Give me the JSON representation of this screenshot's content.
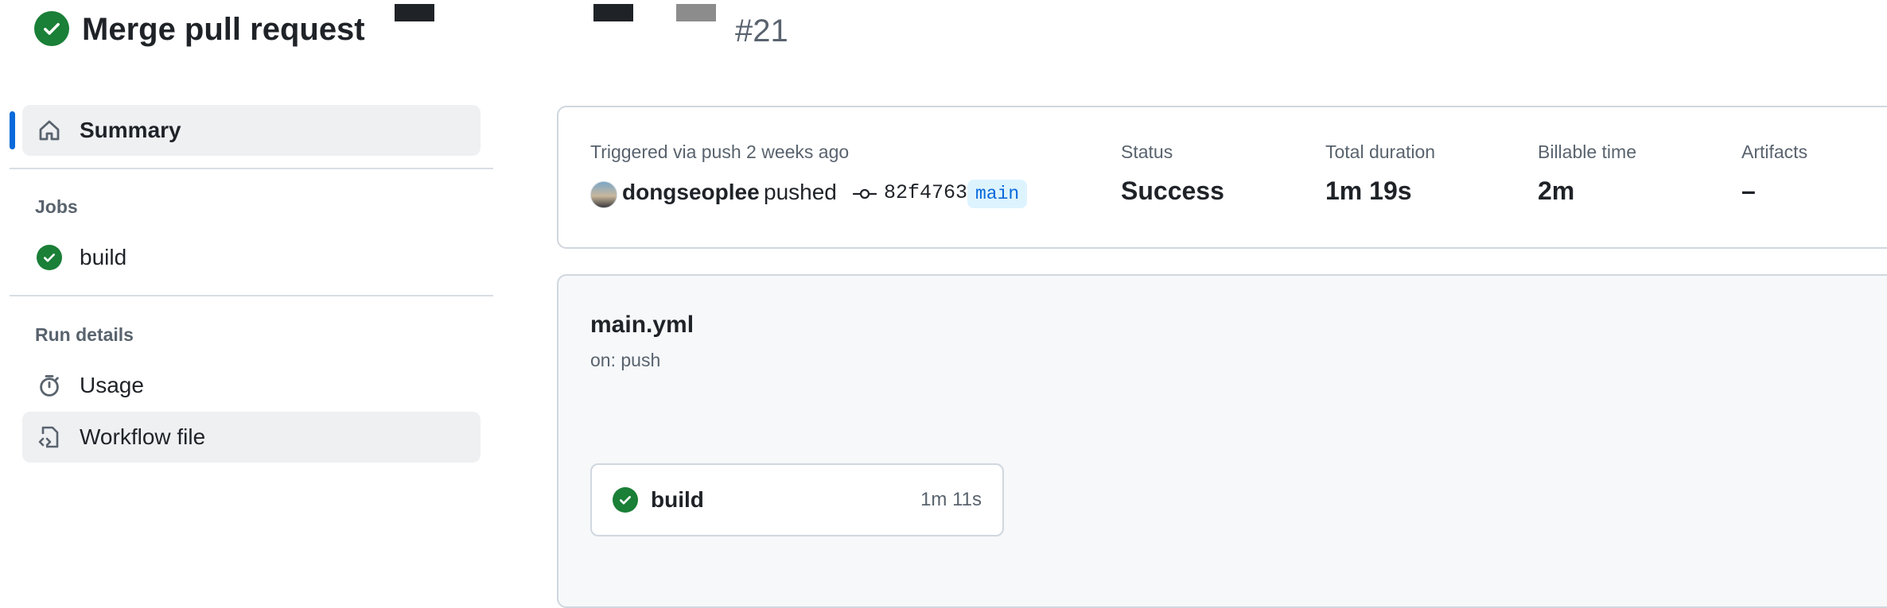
{
  "header": {
    "title": "Merge pull request",
    "run_number": "#21"
  },
  "sidebar": {
    "summary_label": "Summary",
    "jobs_heading": "Jobs",
    "jobs": [
      {
        "label": "build",
        "status": "success"
      }
    ],
    "run_details_heading": "Run details",
    "usage_label": "Usage",
    "workflow_file_label": "Workflow file"
  },
  "summary": {
    "trigger_text": "Triggered via push 2 weeks ago",
    "actor": "dongseoplee",
    "action": "pushed",
    "commit_sha": "82f4763",
    "branch": "main",
    "status_label": "Status",
    "status_value": "Success",
    "duration_label": "Total duration",
    "duration_value": "1m 19s",
    "billable_label": "Billable time",
    "billable_value": "2m",
    "artifacts_label": "Artifacts",
    "artifacts_value": "–"
  },
  "workflow": {
    "file_name": "main.yml",
    "trigger": "on: push",
    "job": {
      "name": "build",
      "duration": "1m 11s"
    }
  },
  "colors": {
    "success": "#1a7f37",
    "accent": "#0969da",
    "branch_bg": "#ddf4ff"
  }
}
